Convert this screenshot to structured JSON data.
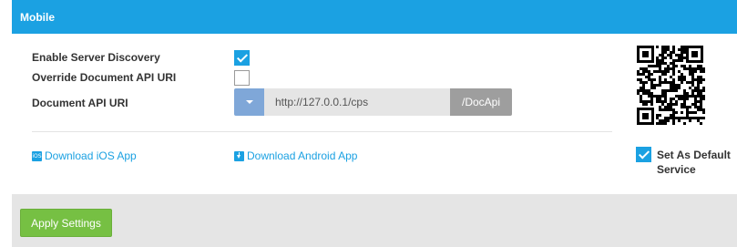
{
  "header": {
    "title": "Mobile"
  },
  "fields": {
    "enable_discovery": {
      "label": "Enable Server Discovery",
      "checked": true
    },
    "override_uri": {
      "label": "Override Document API URI",
      "checked": false
    },
    "document_uri": {
      "label": "Document API URI",
      "value": "http://127.0.0.1/cps",
      "suffix": "/DocApi"
    }
  },
  "links": {
    "ios": {
      "label": "Download iOS App",
      "icon": "ios-icon",
      "icon_text": "iOS"
    },
    "android": {
      "label": "Download Android App",
      "icon": "download-icon"
    }
  },
  "default_service": {
    "label": "Set As Default Service",
    "checked": true
  },
  "qr_code": {
    "icon": "qr-code-icon"
  },
  "footer": {
    "apply_label": "Apply Settings"
  },
  "colors": {
    "accent": "#1ba1e2",
    "apply": "#76c043",
    "footer_bg": "#e5e5e5"
  }
}
